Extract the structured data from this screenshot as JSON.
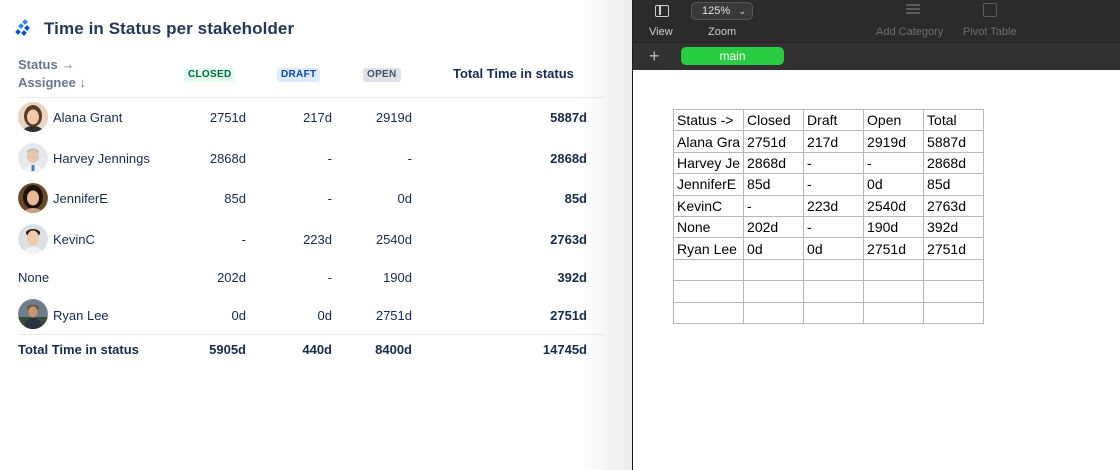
{
  "report": {
    "title": "Time in Status per stakeholder",
    "header": {
      "status_label": "Status →",
      "assignee_label": "Assignee ↓",
      "closed": "CLOSED",
      "draft": "DRAFT",
      "open": "OPEN",
      "total": "Total Time in status"
    },
    "rows": [
      {
        "name": "Alana Grant",
        "closed": "2751d",
        "draft": "217d",
        "open": "2919d",
        "total": "5887d"
      },
      {
        "name": "Harvey Jennings",
        "closed": "2868d",
        "draft": "-",
        "open": "-",
        "total": "2868d"
      },
      {
        "name": "JenniferE",
        "closed": "85d",
        "draft": "-",
        "open": "0d",
        "total": "85d"
      },
      {
        "name": "KevinC",
        "closed": "-",
        "draft": "223d",
        "open": "2540d",
        "total": "2763d"
      },
      {
        "name": "None",
        "closed": "202d",
        "draft": "-",
        "open": "190d",
        "total": "392d"
      },
      {
        "name": "Ryan Lee",
        "closed": "0d",
        "draft": "0d",
        "open": "2751d",
        "total": "2751d"
      }
    ],
    "footer": {
      "label": "Total Time in status",
      "closed": "5905d",
      "draft": "440d",
      "open": "8400d",
      "total": "14745d"
    }
  },
  "numbers": {
    "toolbar": {
      "view_label": "View",
      "zoom_value": "125%",
      "zoom_label": "Zoom",
      "add_category_label": "Add Category",
      "pivot_table_label": "Pivot Table"
    },
    "add_sheet": "+",
    "sheet_tab": "main",
    "table": [
      [
        "Status ->",
        "Closed",
        "Draft",
        "Open",
        "Total"
      ],
      [
        "Alana Gra",
        "2751d",
        "217d",
        "2919d",
        "5887d"
      ],
      [
        "Harvey Je",
        "2868d",
        "-",
        "-",
        "2868d"
      ],
      [
        "JenniferE",
        "85d",
        "-",
        "0d",
        "85d"
      ],
      [
        "KevinC",
        "-",
        "223d",
        "2540d",
        "2763d"
      ],
      [
        "None",
        "202d",
        "-",
        "190d",
        "392d"
      ],
      [
        "Ryan Lee",
        "0d",
        "0d",
        "2751d",
        "2751d"
      ],
      [
        "",
        "",
        "",
        "",
        ""
      ],
      [
        "",
        "",
        "",
        "",
        ""
      ],
      [
        "",
        "",
        "",
        "",
        ""
      ]
    ]
  },
  "colors": {
    "closed_lozenge": "#e3fcef",
    "draft_lozenge": "#deebff",
    "open_lozenge": "#dfe1e6",
    "sheet_tab": "#28cd41",
    "toolbar": "#2b2b2b"
  }
}
